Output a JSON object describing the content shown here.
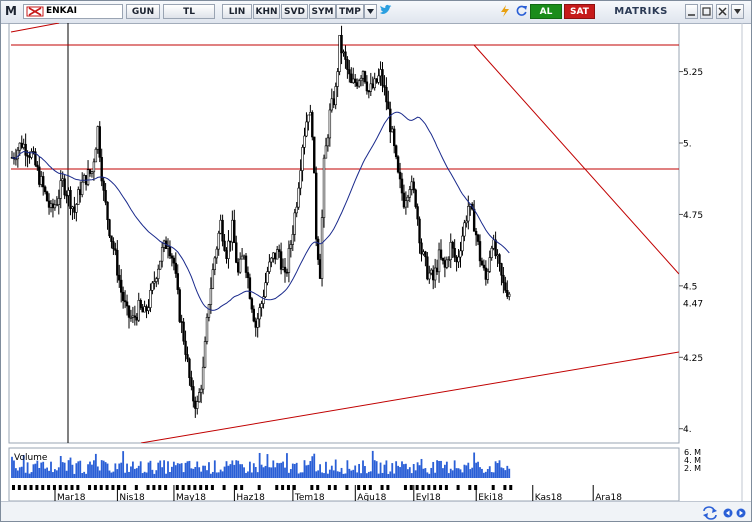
{
  "toolbar": {
    "menu_glyph": "M",
    "symbol_icon": "cross-logo-icon",
    "symbol": "ENKAI",
    "period": "GUN",
    "currency": "TL",
    "scale": "LIN",
    "khn": "KHN",
    "svd": "SVD",
    "sym": "SYM",
    "tmp": "TMP",
    "buy": "AL",
    "sell": "SAT",
    "brand": "MATRIKS"
  },
  "colors": {
    "candle": "#000000",
    "moving_average": "#1a2a8c",
    "trendline": "#c00000",
    "volume": "#2a5fd6",
    "buy": "#1a8c1a",
    "sell": "#c61a1a"
  },
  "chart_data": {
    "type": "candlestick",
    "title": "",
    "x_labels": [
      "Mar18",
      "Nis18",
      "May18",
      "Haz18",
      "Tem18",
      "Ağu18",
      "Eyl18",
      "Eki18",
      "Kas18",
      "Ara18"
    ],
    "x_label_days": [
      53,
      85,
      114,
      145,
      175,
      207,
      237,
      269,
      298,
      329
    ],
    "y_ticks": [
      "5.25",
      "5.",
      "4.75",
      "4.5",
      "4.25",
      "4."
    ],
    "y_tick_values": [
      5.25,
      5.0,
      4.75,
      4.5,
      4.25,
      4.0
    ],
    "last_price": "4.47",
    "ylim": [
      3.95,
      5.42
    ],
    "grid": false,
    "close_series": [
      [
        0,
        4.95
      ],
      [
        5,
        5.0
      ],
      [
        10,
        4.96
      ],
      [
        14,
        4.88
      ],
      [
        17,
        4.82
      ],
      [
        20,
        4.76
      ],
      [
        23,
        4.8
      ],
      [
        26,
        4.86
      ],
      [
        29,
        4.82
      ],
      [
        32,
        4.76
      ],
      [
        35,
        4.84
      ],
      [
        38,
        4.88
      ],
      [
        41,
        4.9
      ],
      [
        44,
        5.05
      ],
      [
        47,
        4.82
      ],
      [
        50,
        4.7
      ],
      [
        53,
        4.6
      ],
      [
        56,
        4.48
      ],
      [
        59,
        4.4
      ],
      [
        62,
        4.38
      ],
      [
        65,
        4.42
      ],
      [
        68,
        4.4
      ],
      [
        71,
        4.46
      ],
      [
        74,
        4.55
      ],
      [
        77,
        4.62
      ],
      [
        80,
        4.66
      ],
      [
        83,
        4.58
      ],
      [
        86,
        4.4
      ],
      [
        89,
        4.28
      ],
      [
        92,
        4.12
      ],
      [
        95,
        4.08
      ],
      [
        98,
        4.2
      ],
      [
        101,
        4.45
      ],
      [
        104,
        4.6
      ],
      [
        107,
        4.72
      ],
      [
        110,
        4.62
      ],
      [
        113,
        4.7
      ],
      [
        116,
        4.54
      ],
      [
        119,
        4.62
      ],
      [
        122,
        4.48
      ],
      [
        125,
        4.36
      ],
      [
        128,
        4.44
      ],
      [
        131,
        4.55
      ],
      [
        134,
        4.6
      ],
      [
        137,
        4.62
      ],
      [
        140,
        4.52
      ],
      [
        143,
        4.65
      ],
      [
        146,
        4.8
      ],
      [
        149,
        5.0
      ],
      [
        152,
        5.12
      ],
      [
        154,
        5.05
      ],
      [
        156,
        4.68
      ],
      [
        158,
        4.55
      ],
      [
        160,
        4.92
      ],
      [
        163,
        5.1
      ],
      [
        166,
        5.18
      ],
      [
        168,
        5.35
      ],
      [
        171,
        5.28
      ],
      [
        174,
        5.2
      ],
      [
        177,
        5.22
      ],
      [
        180,
        5.26
      ],
      [
        183,
        5.18
      ],
      [
        186,
        5.2
      ],
      [
        189,
        5.24
      ],
      [
        192,
        5.15
      ],
      [
        195,
        5.02
      ],
      [
        198,
        4.88
      ],
      [
        201,
        4.8
      ],
      [
        204,
        4.86
      ],
      [
        207,
        4.8
      ],
      [
        210,
        4.62
      ],
      [
        213,
        4.55
      ],
      [
        216,
        4.52
      ],
      [
        219,
        4.6
      ],
      [
        222,
        4.56
      ],
      [
        225,
        4.64
      ],
      [
        228,
        4.58
      ],
      [
        231,
        4.68
      ],
      [
        234,
        4.78
      ],
      [
        237,
        4.72
      ],
      [
        240,
        4.6
      ],
      [
        243,
        4.52
      ],
      [
        246,
        4.66
      ],
      [
        249,
        4.58
      ],
      [
        252,
        4.5
      ],
      [
        255,
        4.48
      ]
    ],
    "volume_axis_ticks": [
      "6. M",
      "4. M",
      "2. M"
    ],
    "volume_label": "Volume"
  },
  "footer": {
    "mode_icon": "switch-arrows-icon",
    "scroll_left_icon": "scroll-left-icon",
    "scroll_right_icon": "scroll-right-icon"
  }
}
